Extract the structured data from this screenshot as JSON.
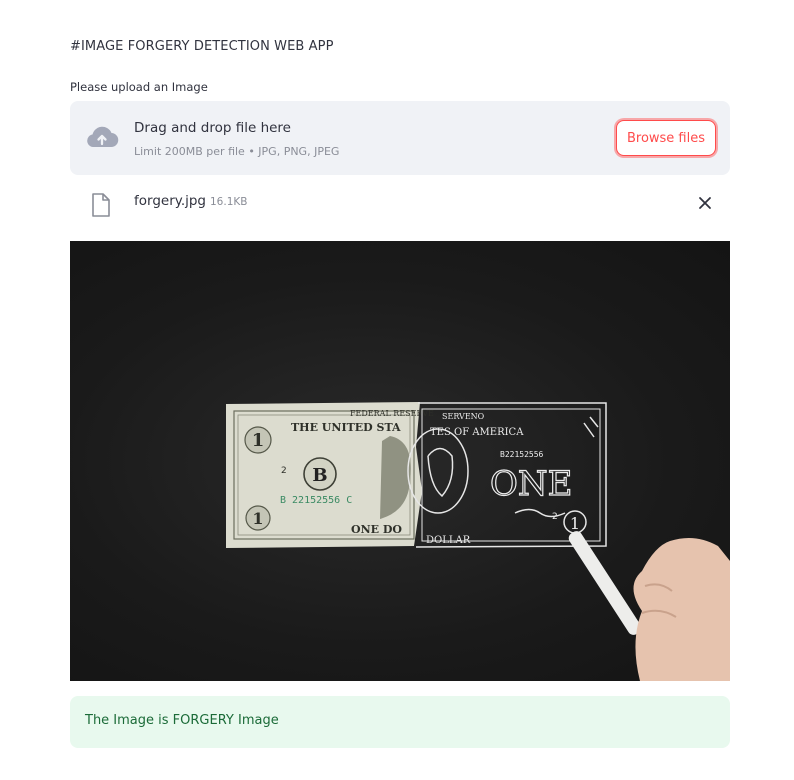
{
  "header": {
    "title": "#IMAGE FORGERY DETECTION WEB APP"
  },
  "uploader": {
    "label": "Please upload an Image",
    "drop_title": "Drag and drop file here",
    "drop_subtitle": "Limit 200MB per file • JPG, PNG, JPEG",
    "browse_label": "Browse files",
    "icon": "cloud-upload-icon",
    "accent_color": "#ff4b4b"
  },
  "uploaded_file": {
    "name": "forgery.jpg",
    "size": "16.1KB",
    "icon": "file-icon"
  },
  "preview": {
    "bill_left_text": {
      "header": "THE UNITED STA",
      "banner": "FEDERAL RESERVE",
      "seal_letter": "B",
      "serial": "B 22152556 C",
      "corner_num": "1",
      "bottom": "ONE DO",
      "small": "2"
    },
    "bill_right_text": {
      "header": "TES OF AMERICA",
      "banner": "SERVENO",
      "serial": "B22152556",
      "big_word": "ONE",
      "bottom": "DOLLAR",
      "corner_num": "1",
      "small": "2"
    }
  },
  "result": {
    "text": "The Image is FORGERY Image",
    "bg_color": "#e8f9ee",
    "text_color": "#1b6b38"
  }
}
